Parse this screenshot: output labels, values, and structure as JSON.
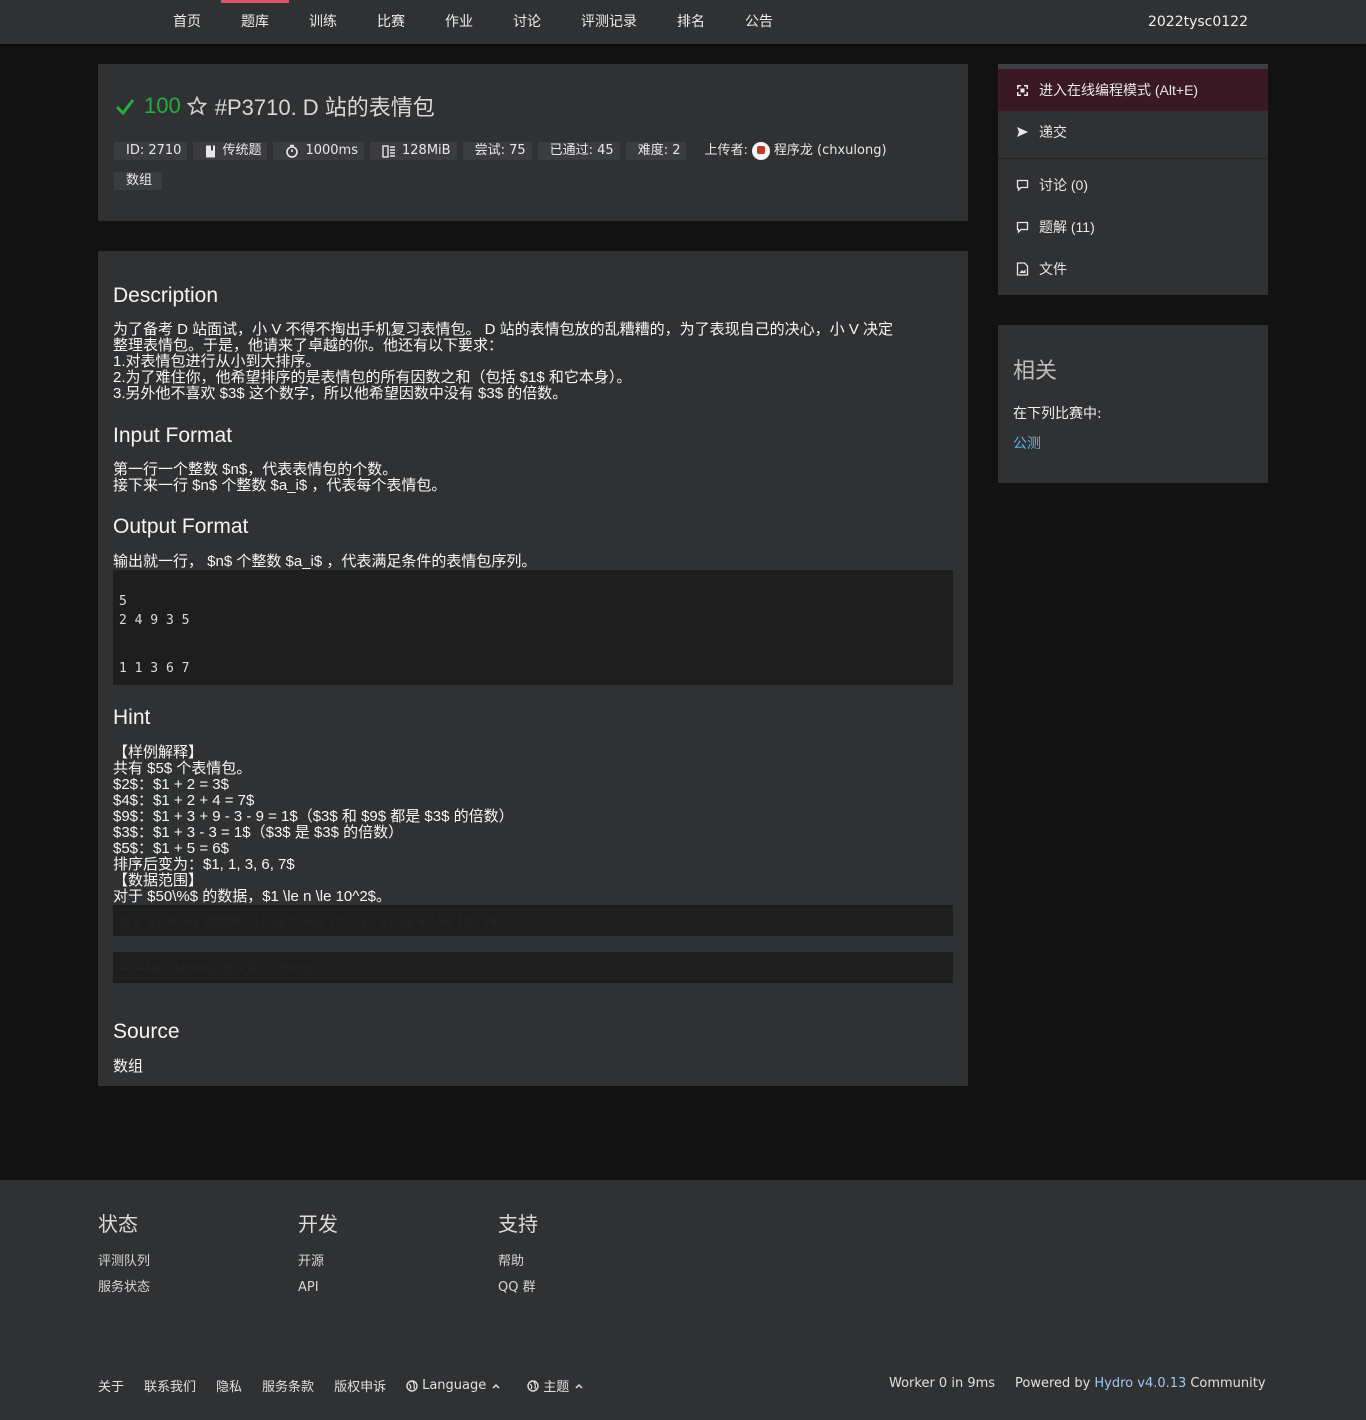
{
  "nav": {
    "items": [
      "首页",
      "题库",
      "训练",
      "比赛",
      "作业",
      "讨论",
      "评测记录",
      "排名",
      "公告"
    ],
    "active": "题库",
    "user": "2022tysc0122"
  },
  "problem": {
    "score": "100",
    "title": "#P3710. D 站的表情包",
    "meta": {
      "id": "ID: 2710",
      "type": "传统题",
      "time": "1000ms",
      "memory": "128MiB",
      "tried": "尝试: 75",
      "passed": "已通过: 45",
      "difficulty": "难度: 2",
      "uploader_label": "上传者:",
      "uploader": "程序龙 (chxulong)",
      "tag": "数组"
    }
  },
  "content": {
    "description_title": "Description",
    "description_lines": [
      "为了备考 D 站面试，小 V 不得不掏出手机复习表情包。 D 站的表情包放的乱糟糟的，为了表现自己的决心，小 V 决定",
      "整理表情包。于是，他请来了卓越的你。他还有以下要求：",
      "1.对表情包进行从小到大排序。",
      "2.为了难住你，他希望排序的是表情包的所有因数之和（包括 $1$ 和它本身）。",
      "3.另外他不喜欢 $3$ 这个数字，所以他希望因数中没有 $3$ 的倍数。"
    ],
    "input_title": "Input Format",
    "input_lines": [
      "第一行一个整数 $n$，代表表情包的个数。",
      "接下来一行 $n$ 个整数 $a_i$ ，代表每个表情包。"
    ],
    "output_title": "Output Format",
    "output_lines": [
      "输出就一行， $n$ 个整数 $a_i$ ，代表满足条件的表情包序列。"
    ],
    "sample_input_lines": [
      "5",
      "2 4 9 3 5"
    ],
    "sample_output_lines": [
      "1 1 3 6 7"
    ],
    "hint_title": "Hint",
    "hint_lines": [
      "【样例解释】",
      "共有 $5$ 个表情包。",
      "$2$：$1 + 2 = 3$",
      "$4$：$1 + 2 + 4 = 7$",
      "$9$：$1 + 3 + 9 - 3 - 9 = 1$（$3$ 和 $9$ 都是 $3$ 的倍数）",
      "$3$：$1 + 3 - 3 = 1$（$3$ 是 $3$ 的倍数）",
      "$5$：$1 + 5 = 6$",
      "排序后变为：$1, 1, 3, 6, 7$",
      "【数据范围】",
      "对于 $50\\%$ 的数据，$1 \\le n \\le 10^2$。"
    ],
    "hint_code_1": "对于 $100\\%$ 的数据，$1 \\le n \\leq 10^3$，$2 \\le a_i \\le 10^3$。",
    "hint_code_2": "— —by <strong>出文题</strong>",
    "source_title": "Source",
    "source_value": "数组"
  },
  "sidebar": {
    "actions": [
      "进入在线编程模式 (Alt+E)",
      "递交"
    ],
    "links": [
      "讨论 (0)",
      "题解 (11)",
      "文件"
    ],
    "related_title": "相关",
    "related_label": "在下列比赛中:",
    "related_link": "公测"
  },
  "footer": {
    "columns": [
      {
        "title": "状态",
        "links": [
          "评测队列",
          "服务状态"
        ]
      },
      {
        "title": "开发",
        "links": [
          "开源",
          "API"
        ]
      },
      {
        "title": "支持",
        "links": [
          "帮助",
          "QQ 群"
        ]
      }
    ],
    "bottom_links": [
      "关于",
      "联系我们",
      "隐私",
      "服务条款",
      "版权申诉"
    ],
    "language": "Language",
    "theme": "主题",
    "worker": "Worker 0 in 9ms",
    "powered_prefix": "Powered by",
    "powered_link": "Hydro v4.0.13",
    "powered_suffix": "Community"
  },
  "colors": {
    "accent": "#e0536e",
    "pass_green": "#25ad40",
    "link_blue": "#55b5f0"
  }
}
